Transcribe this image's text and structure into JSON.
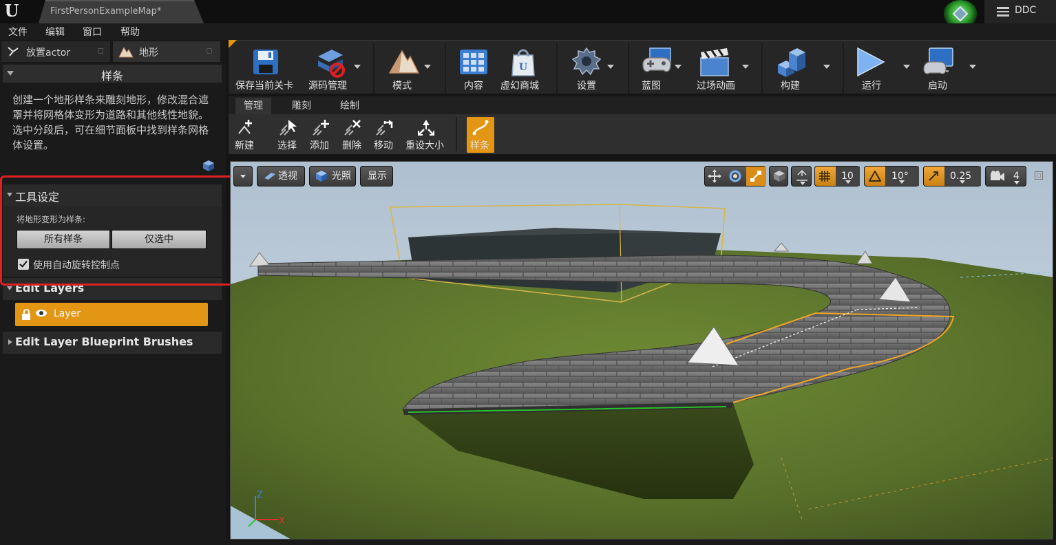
{
  "window": {
    "tab_title": "FirstPersonExampleMap*",
    "ddc_label": "DDC"
  },
  "menu": {
    "items": [
      "文件",
      "编辑",
      "窗口",
      "帮助"
    ]
  },
  "left_panel": {
    "tabs": [
      {
        "label": "放置actor",
        "icon": "place-actor-icon"
      },
      {
        "label": "地形",
        "icon": "landscape-icon"
      }
    ],
    "section_title": "样条",
    "description": "创建一个地形样条来雕刻地形，修改混合遮罩并将网格体变形为道路和其他线性地貌。选中分段后，可在细节面板中找到样条网格体设置。",
    "tool_settings": {
      "header": "工具设定",
      "deform_label": "将地形变形为样条:",
      "btn_all_splines": "所有样条",
      "btn_selected_only": "仅选中",
      "auto_rotate_label": "使用自动旋转控制点",
      "auto_rotate_checked": true
    },
    "edit_layers": {
      "header": "Edit Layers",
      "layer_name": "Layer"
    },
    "bp_brushes_header": "Edit Layer Blueprint Brushes"
  },
  "toolbar": {
    "buttons": [
      {
        "label": "保存当前关卡",
        "icon": "save-floppy-icon"
      },
      {
        "label": "源码管理",
        "icon": "source-control-icon"
      },
      {
        "label": "模式",
        "icon": "modes-icon"
      },
      {
        "label": "内容",
        "icon": "content-browser-icon"
      },
      {
        "label": "虚幻商城",
        "icon": "marketplace-bag-icon"
      },
      {
        "label": "设置",
        "icon": "settings-gear-icon"
      },
      {
        "label": "蓝图",
        "icon": "blueprint-gamepad-icon"
      },
      {
        "label": "过场动画",
        "icon": "cinematics-clapper-icon"
      },
      {
        "label": "构建",
        "icon": "build-cubes-icon"
      },
      {
        "label": "运行",
        "icon": "play-icon"
      },
      {
        "label": "启动",
        "icon": "launch-monitor-icon"
      }
    ]
  },
  "mode_tabs": [
    "管理",
    "雕刻",
    "绘制"
  ],
  "mode_tools": [
    {
      "label": "新建",
      "icon": "new-icon"
    },
    {
      "label": "选择",
      "icon": "select-icon"
    },
    {
      "label": "添加",
      "icon": "add-icon"
    },
    {
      "label": "删除",
      "icon": "delete-icon"
    },
    {
      "label": "移动",
      "icon": "move-icon"
    },
    {
      "label": "重设大小",
      "icon": "resize-icon"
    },
    {
      "label": "样条",
      "icon": "spline-icon"
    }
  ],
  "viewport": {
    "btn_perspective": "透视",
    "btn_lighting": "光照",
    "btn_show": "显示",
    "grid_snap": "10",
    "rotation_snap": "10°",
    "scale_snap": "0.25",
    "camera_speed": "4",
    "axis_labels": {
      "z": "Z",
      "x": "X"
    },
    "colors": {
      "accent": "#e39614",
      "highlight_box": "#e02020",
      "grass": "#5d7a2c",
      "sky": "#c7d6e3"
    }
  }
}
